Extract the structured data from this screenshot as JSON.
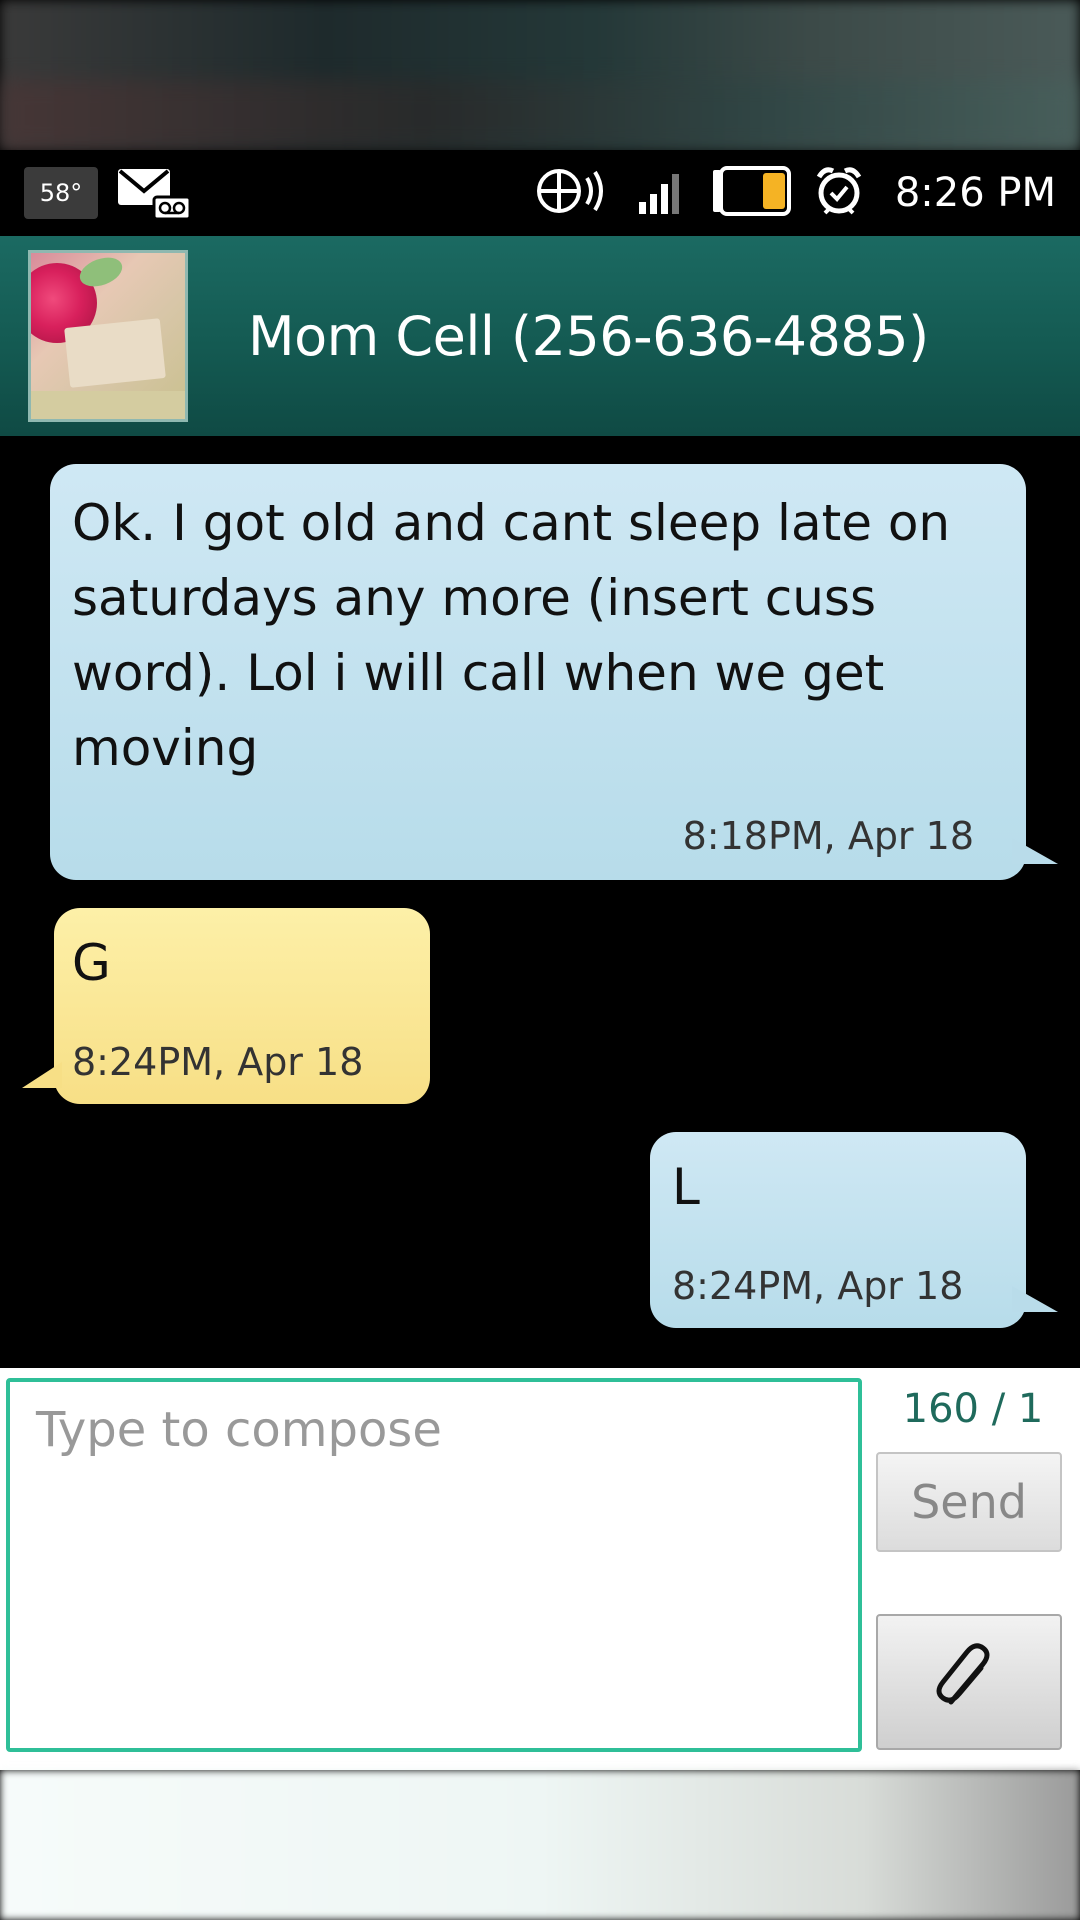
{
  "status_bar": {
    "temperature": "58°",
    "time": "8:26 PM",
    "icons": [
      "voicemail-mail-icon",
      "data-sync-icon",
      "signal-icon",
      "battery-icon",
      "alarm-icon"
    ]
  },
  "contact": {
    "name": "Mom Cell (256-636-4885)"
  },
  "messages": [
    {
      "direction": "outgoing",
      "text": "Ok. I got old and cant sleep late on saturdays any more (insert cuss word). Lol i will call when we get moving",
      "timestamp": "8:18PM, Apr 18"
    },
    {
      "direction": "incoming",
      "text": "G",
      "timestamp": "8:24PM, Apr 18"
    },
    {
      "direction": "outgoing",
      "text": "L",
      "timestamp": "8:24PM, Apr 18"
    }
  ],
  "compose": {
    "placeholder": "Type to compose",
    "char_count": "160 / 1",
    "send_label": "Send"
  },
  "colors": {
    "header": "#145a52",
    "outgoing_bubble": "#c2e2ee",
    "incoming_bubble": "#f9e594",
    "compose_border": "#2fbf98",
    "char_count": "#1f6a5c"
  }
}
